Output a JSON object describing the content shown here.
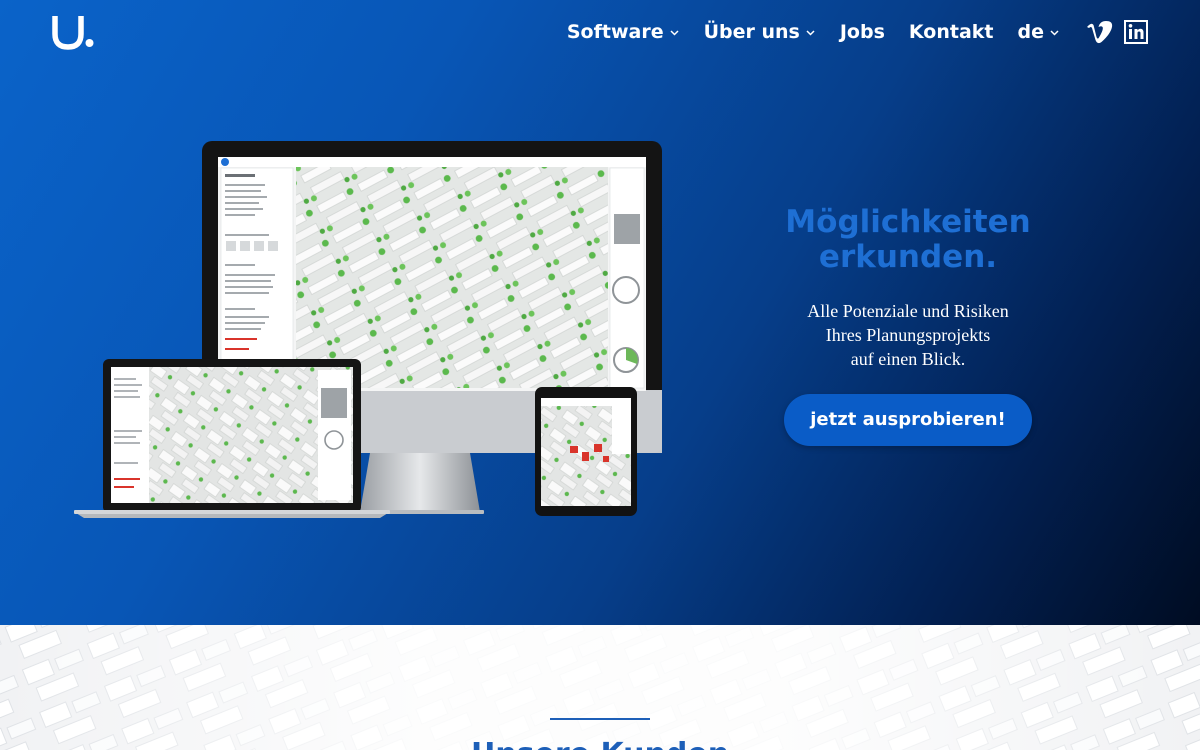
{
  "brand": {
    "logo_icon": "u-dot-logo-icon"
  },
  "nav": {
    "items": [
      {
        "label": "Software",
        "has_dropdown": true
      },
      {
        "label": "Über uns",
        "has_dropdown": true
      },
      {
        "label": "Jobs",
        "has_dropdown": false
      },
      {
        "label": "Kontakt",
        "has_dropdown": false
      },
      {
        "label": "de",
        "has_dropdown": true
      }
    ],
    "social": [
      {
        "icon": "vimeo-icon"
      },
      {
        "icon": "linkedin-icon"
      }
    ]
  },
  "hero": {
    "headline_line1": "Möglichkeiten",
    "headline_line2": "erkunden.",
    "subtext_line1": "Alle Potenziale und Risiken",
    "subtext_line2": "Ihres Planungsprojekts",
    "subtext_line3": "auf einen Blick.",
    "cta_label": "jetzt ausprobieren!"
  },
  "next_section": {
    "heading": "Unsere Kunden"
  },
  "colors": {
    "hero_gradient_start": "#0a63c9",
    "hero_gradient_end": "#000c22",
    "headline": "#1e6fd4",
    "cta_background": "#0a5cc7",
    "section_heading": "#1d5fb8"
  }
}
